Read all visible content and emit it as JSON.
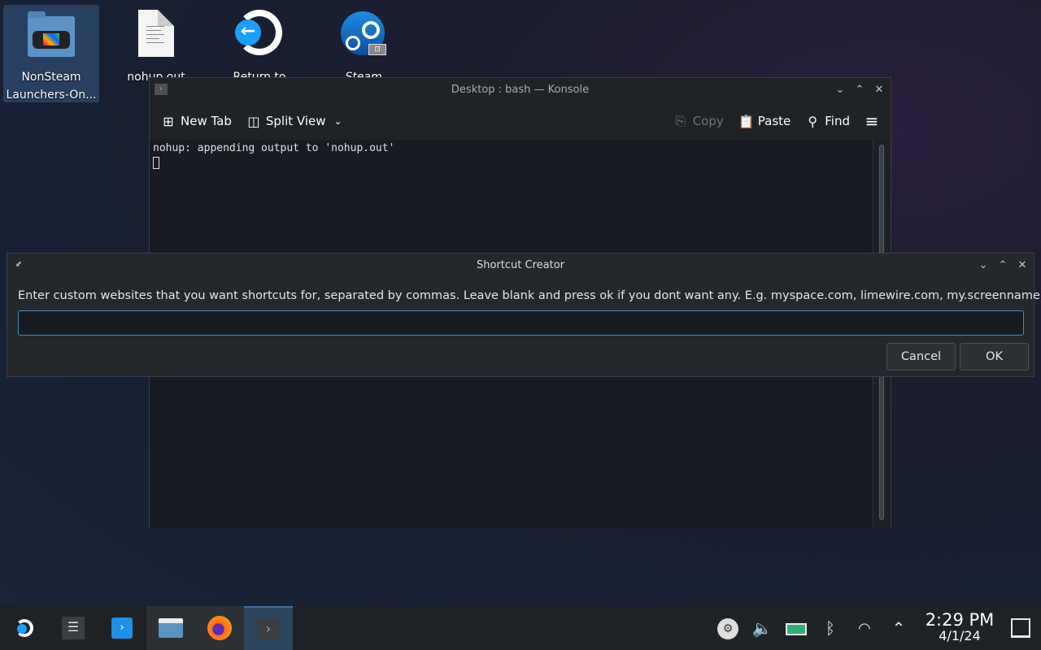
{
  "desktop": {
    "icons": [
      {
        "label_line1": "NonSteam",
        "label_line2": "Launchers-On...",
        "icon": "folder-steamdeck-icon",
        "selected": true
      },
      {
        "label_line1": "nohup.out",
        "icon": "text-file-icon"
      },
      {
        "label_line1": "Return to",
        "icon": "return-to-gaming-mode-icon"
      },
      {
        "label_line1": "Steam",
        "icon": "steam-icon"
      }
    ]
  },
  "konsole": {
    "title": "Desktop : bash — Konsole",
    "toolbar": {
      "new_tab": "New Tab",
      "split_view": "Split View",
      "copy": "Copy",
      "paste": "Paste",
      "find": "Find"
    },
    "terminal_lines": [
      "nohup: appending output to 'nohup.out'"
    ]
  },
  "dialog": {
    "title": "Shortcut Creator",
    "prompt": "Enter custom websites that you want shortcuts for, separated by commas. Leave blank and press ok if you dont want any. E.g. myspace.com, limewire.com, my.screenname.aol.com",
    "input_value": "",
    "cancel": "Cancel",
    "ok": "OK"
  },
  "taskbar": {
    "apps": [
      "steam-launcher",
      "system-settings",
      "discover",
      "dolphin-file-manager",
      "firefox",
      "konsole"
    ],
    "clock": {
      "time": "2:29 PM",
      "date": "4/1/24"
    }
  }
}
